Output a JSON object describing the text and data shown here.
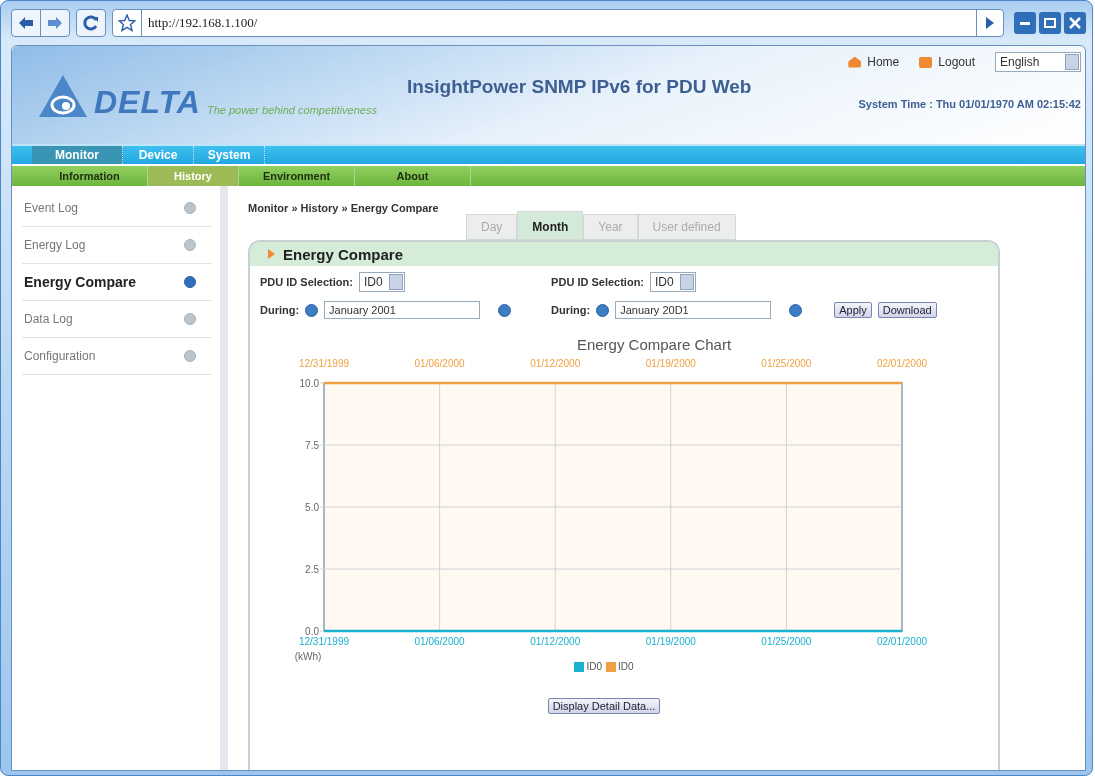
{
  "browser": {
    "url": "http://192.168.1.100/"
  },
  "header": {
    "logo_text": "DELTA",
    "tagline": "The power behind competitiveness",
    "title": "InsightPower SNMP IPv6 for PDU Web",
    "links": [
      {
        "label": "Home",
        "kind": "home"
      },
      {
        "label": "Logout",
        "kind": "logout"
      }
    ],
    "language": "English",
    "system_time": "System Time : Thu 01/01/1970 AM 02:15:42"
  },
  "main_nav": [
    {
      "label": "Monitor",
      "selected": true
    },
    {
      "label": "Device",
      "selected": false
    },
    {
      "label": "System",
      "selected": false
    }
  ],
  "sub_nav": [
    {
      "label": "Information",
      "selected": false
    },
    {
      "label": "History",
      "selected": true
    },
    {
      "label": "Environment",
      "selected": false
    },
    {
      "label": "About",
      "selected": false
    }
  ],
  "sidebar": {
    "items": [
      {
        "label": "Event Log",
        "selected": false
      },
      {
        "label": "Energy Log",
        "selected": false
      },
      {
        "label": "Energy Compare",
        "selected": true
      },
      {
        "label": "Data Log",
        "selected": false
      },
      {
        "label": "Configuration",
        "selected": false
      }
    ]
  },
  "breadcrumb": "Monitor » History » Energy Compare",
  "tabs": [
    {
      "label": "Day",
      "selected": false
    },
    {
      "label": "Month",
      "selected": true
    },
    {
      "label": "Year",
      "selected": false
    },
    {
      "label": "User defined",
      "selected": false
    }
  ],
  "panel": {
    "title": "Energy Compare",
    "selectors": [
      {
        "label": "PDU ID Selection:",
        "value": "ID0",
        "during_label": "During:",
        "during_value": "January 2001"
      },
      {
        "label": "PDU ID Selection:",
        "value": "ID0",
        "during_label": "During:",
        "during_value": "January 20D1"
      }
    ],
    "buttons": [
      "Apply",
      "Download"
    ],
    "chart_title": "Energy Compare Chart",
    "top_labels": [
      "12/31/1999",
      "01/06/2000",
      "01/12/2000",
      "01/19/2000",
      "01/25/2000",
      "02/01/2000"
    ],
    "chart_data": {
      "type": "line",
      "grid": true,
      "categories": [
        "12/31/1999",
        "01/06/2000",
        "01/12/2000",
        "01/19/2000",
        "01/25/2000",
        "02/01/2000"
      ],
      "ylabel": "(kWh)",
      "ylim": [
        0,
        10
      ],
      "yticks": [
        {
          "value": 0,
          "label": "0.0"
        },
        {
          "value": 2.5,
          "label": "2.5"
        },
        {
          "value": 5,
          "label": "5.0"
        },
        {
          "value": 7.5,
          "label": "7.5"
        },
        {
          "value": 10,
          "label": "10.0"
        }
      ],
      "series": [
        {
          "name": "ID0",
          "color": "#1ab0d0",
          "values": [
            0,
            0,
            0,
            0,
            0,
            0
          ]
        },
        {
          "name": "ID0",
          "color": "#f0a040",
          "values": [
            10,
            10,
            10,
            10,
            10,
            10
          ]
        }
      ]
    },
    "detail_button": "Display Detail Data..."
  }
}
